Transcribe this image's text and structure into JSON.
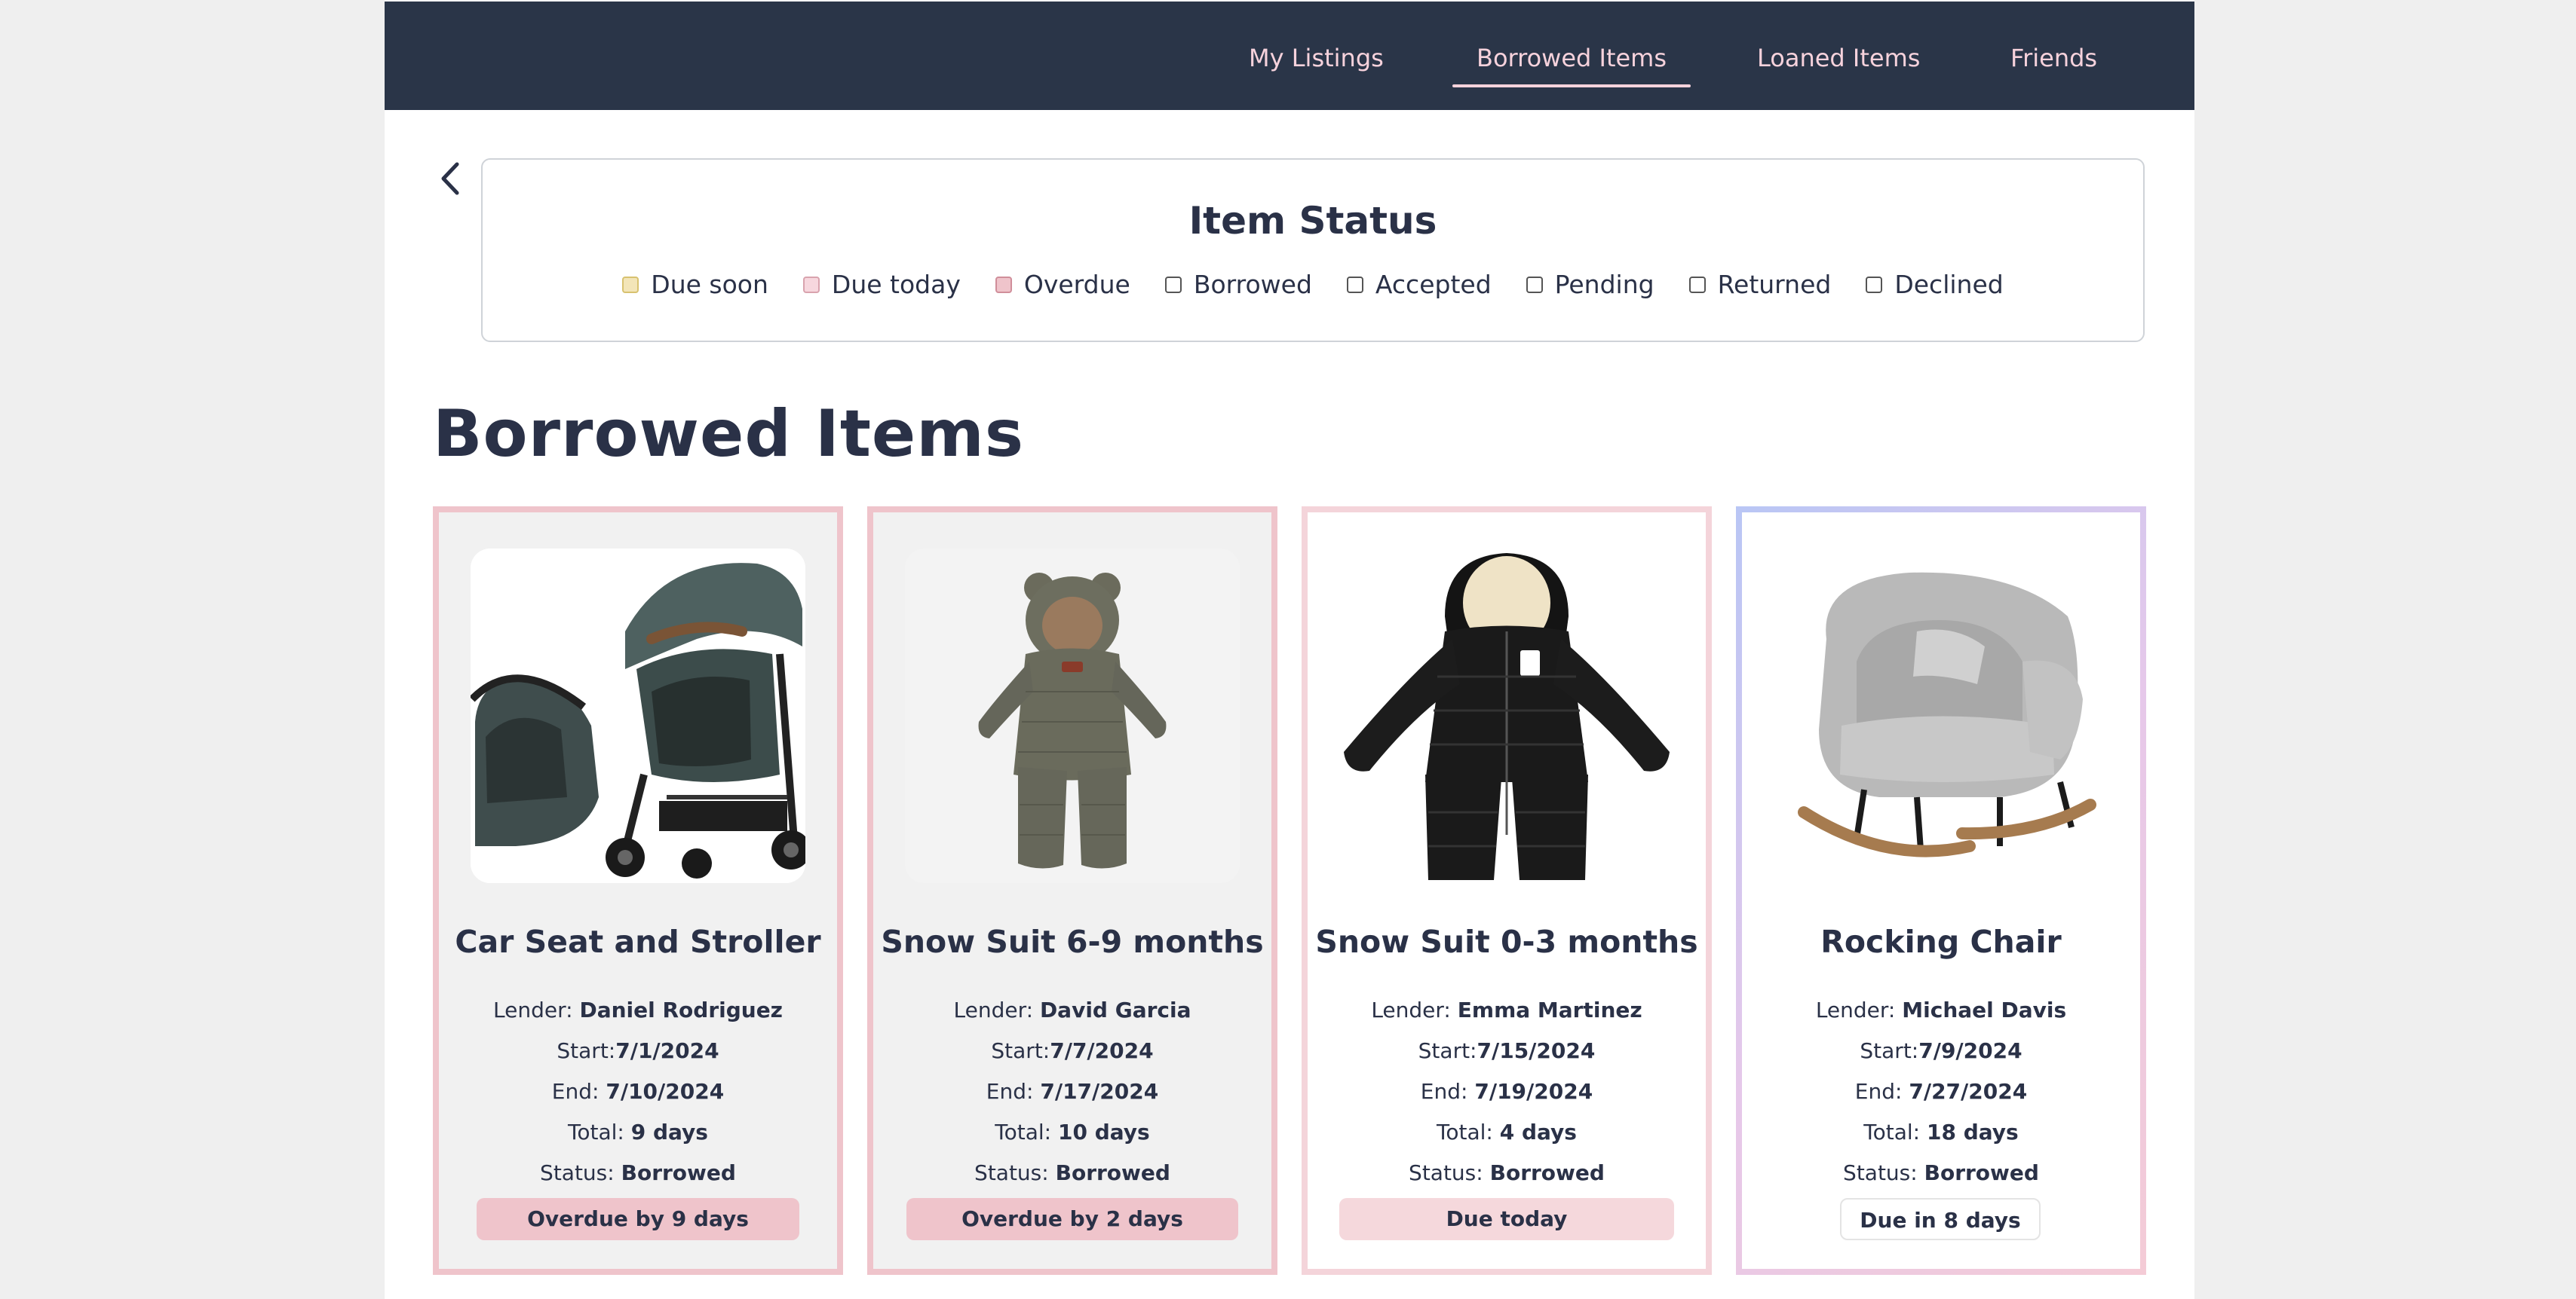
{
  "nav": {
    "items": [
      {
        "label": "My Listings",
        "active": false
      },
      {
        "label": "Borrowed Items",
        "active": true
      },
      {
        "label": "Loaned Items",
        "active": false
      },
      {
        "label": "Friends",
        "active": false
      }
    ]
  },
  "legend": {
    "title": "Item Status",
    "items": [
      {
        "label": "Due soon",
        "color": "#f3e5b8"
      },
      {
        "label": "Due today",
        "color": "#f7d7de"
      },
      {
        "label": "Overdue",
        "color": "#efc4cb"
      },
      {
        "label": "Borrowed",
        "color": "#ffffff"
      },
      {
        "label": "Accepted",
        "color": "#ffffff"
      },
      {
        "label": "Pending",
        "color": "#ffffff"
      },
      {
        "label": "Returned",
        "color": "#ffffff"
      },
      {
        "label": "Declined",
        "color": "#ffffff"
      }
    ]
  },
  "page_title": "Borrowed Items",
  "labels": {
    "lender": "Lender:",
    "start": "Start:",
    "end": "End:",
    "total": "Total:",
    "status": "Status:"
  },
  "cards": [
    {
      "title": "Car Seat and Stroller",
      "image": "stroller-image",
      "lender": "Daniel Rodriguez",
      "start": "7/1/2024",
      "end": "7/10/2024",
      "total": "9 days",
      "status": "Borrowed",
      "badge": "Overdue by 9 days",
      "state": "overdue"
    },
    {
      "title": "Snow Suit 6-9 months",
      "image": "olive-snowsuit-image",
      "lender": "David Garcia",
      "start": "7/7/2024",
      "end": "7/17/2024",
      "total": "10 days",
      "status": "Borrowed",
      "badge": "Overdue by 2 days",
      "state": "overdue"
    },
    {
      "title": "Snow Suit 0-3 months",
      "image": "black-snowsuit-image",
      "lender": "Emma Martinez",
      "start": "7/15/2024",
      "end": "7/19/2024",
      "total": "4 days",
      "status": "Borrowed",
      "badge": "Due today",
      "state": "due-today"
    },
    {
      "title": "Rocking Chair",
      "image": "rocking-chair-image",
      "lender": "Michael Davis",
      "start": "7/9/2024",
      "end": "7/27/2024",
      "total": "18 days",
      "status": "Borrowed",
      "badge": "Due in 8 days",
      "state": "upcoming"
    }
  ],
  "colors": {
    "navbar": "#2a3548",
    "nav_text": "#f6d2dc",
    "overdue_border": "#efc4cb",
    "overdue_bg": "#f1f1f1",
    "overdue_badge": "#efc4cb",
    "due_today_border": "#f4d4da",
    "due_today_badge": "#f5d8dc",
    "upcoming_border_start": "#b9c6f5",
    "upcoming_border_end": "#f4cbd6"
  }
}
